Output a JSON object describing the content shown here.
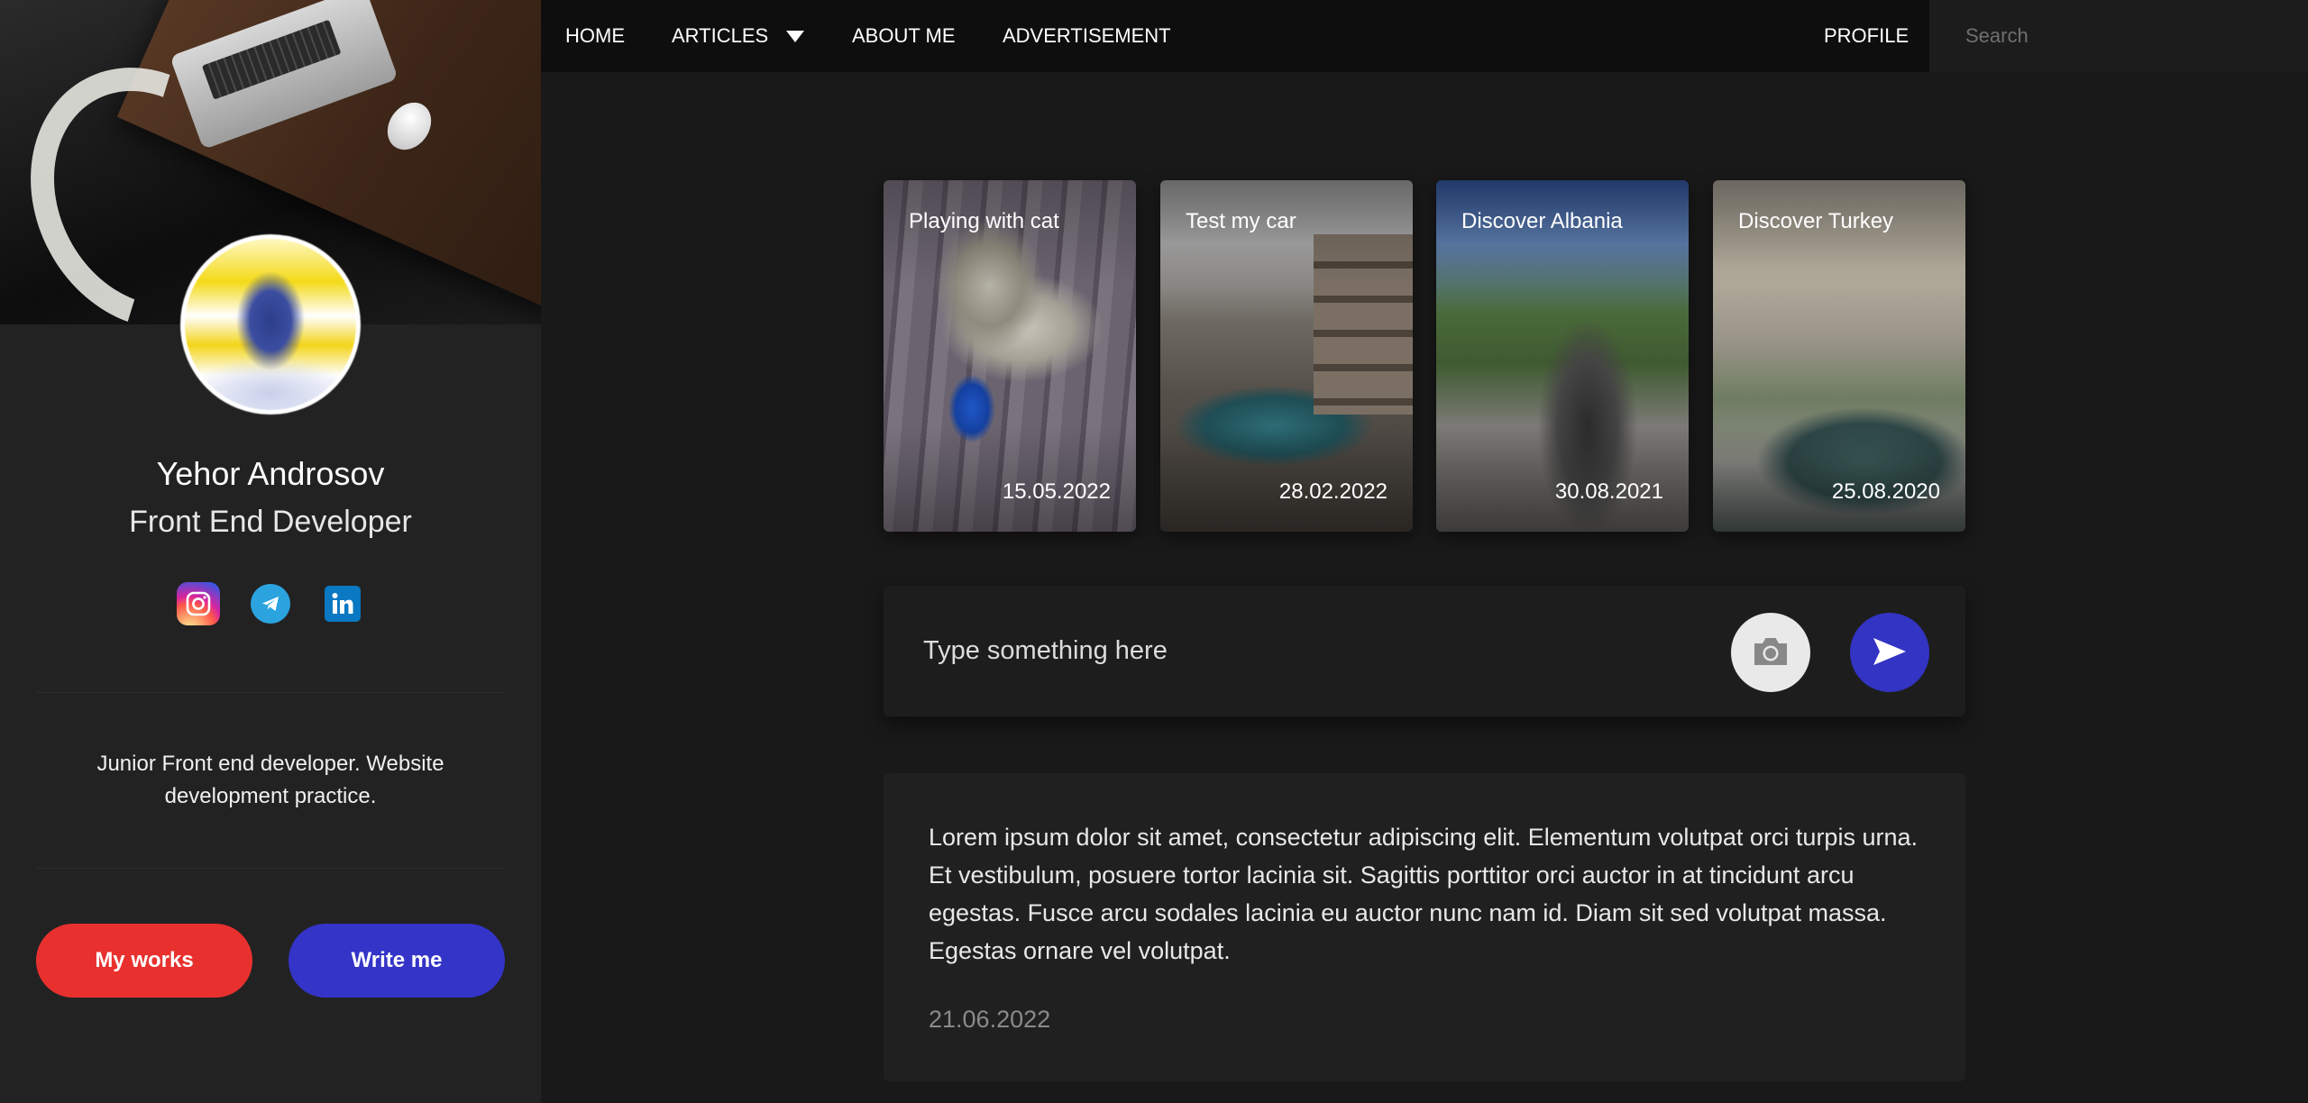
{
  "nav": {
    "items": [
      {
        "label": "HOME"
      },
      {
        "label": "ARTICLES"
      },
      {
        "label": "ABOUT ME"
      },
      {
        "label": "ADVERTISEMENT"
      }
    ],
    "profile_label": "PROFILE",
    "search_placeholder": "Search"
  },
  "profile": {
    "name": "Yehor Androsov",
    "role": "Front End Developer",
    "socials": [
      "instagram-icon",
      "telegram-icon",
      "linkedin-icon"
    ],
    "bio": "Junior Front end developer. Website development practice.",
    "buttons": {
      "works": "My works",
      "write": "Write me"
    }
  },
  "stories": [
    {
      "title": "Playing with cat",
      "date": "15.05.2022"
    },
    {
      "title": "Test my car",
      "date": "28.02.2022"
    },
    {
      "title": "Discover Albania",
      "date": "30.08.2021"
    },
    {
      "title": "Discover Turkey",
      "date": "25.08.2020"
    }
  ],
  "composer": {
    "placeholder": "Type something here",
    "camera_icon": "camera-icon",
    "send_icon": "send-icon"
  },
  "post": {
    "text": "Lorem ipsum dolor sit amet, consectetur adipiscing elit. Elementum volutpat orci turpis urna. Et vestibulum, posuere tortor lacinia sit. Sagittis porttitor orci auctor in at tincidunt arcu egestas. Fusce arcu sodales lacinia eu auctor nunc nam id. Diam sit sed volutpat massa. Egestas ornare vel volutpat.",
    "date": "21.06.2022"
  },
  "colors": {
    "accent_red": "#e8312f",
    "accent_blue": "#3434c8",
    "background": "#191919",
    "sidebar": "#222222",
    "navbar": "#0e0e0e"
  }
}
